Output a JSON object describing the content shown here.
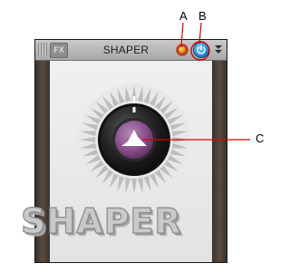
{
  "callouts": {
    "a": "A",
    "b": "B",
    "c": "C"
  },
  "plugin": {
    "fx_badge": "FX",
    "title": "SHAPER",
    "brand_text": "SHAPER"
  },
  "colors": {
    "led": "#f08a00",
    "power": "#1d8de0",
    "knob_cap": "#8a4f8c",
    "callout_line": "#e00000"
  },
  "icons": {
    "led": "led-indicator-icon",
    "power": "power-icon",
    "menu": "double-chevron-down-icon",
    "knob_symbol": "shaper-curve-icon"
  }
}
